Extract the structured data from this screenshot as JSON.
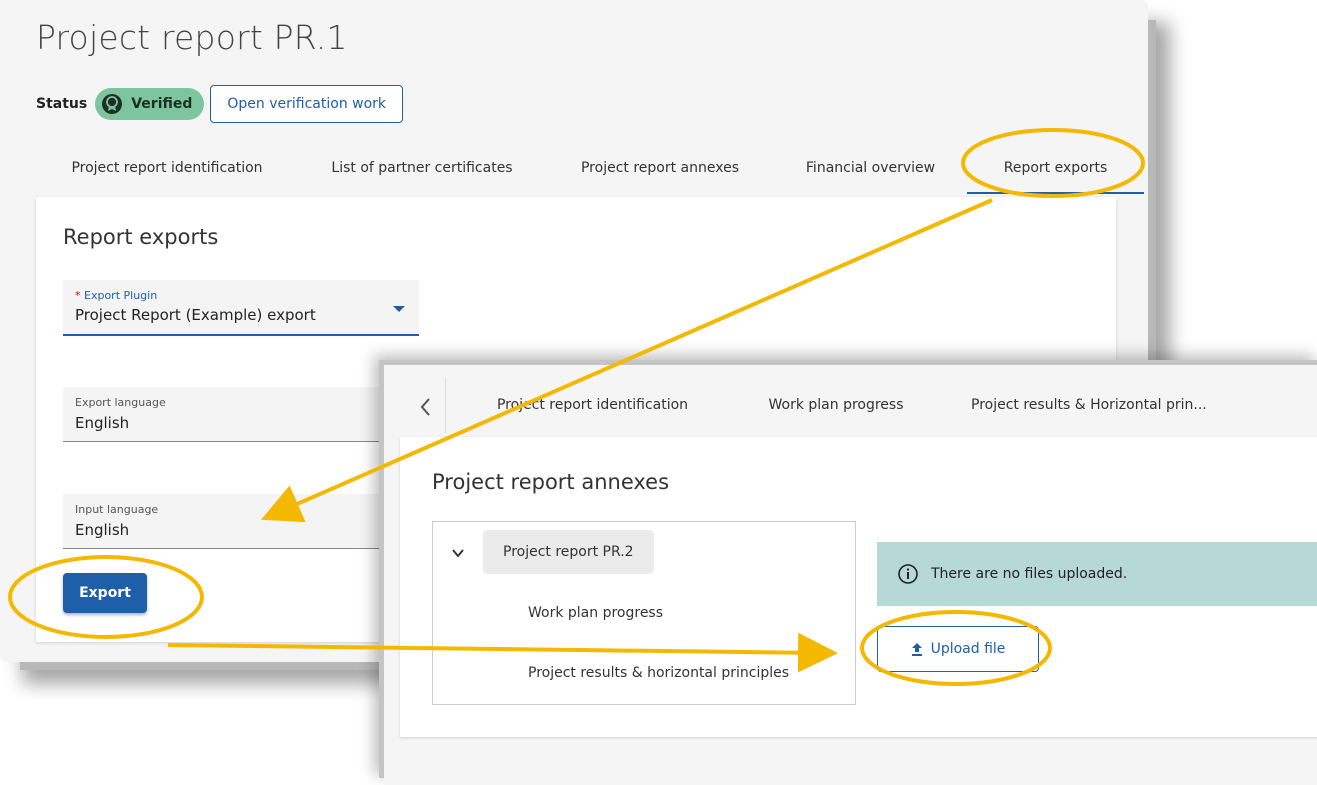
{
  "win1": {
    "title": "Project report PR.1",
    "status_label": "Status",
    "status_badge": "Verified",
    "open_verification_label": "Open verification work",
    "tabs": [
      {
        "label": "Project report identification"
      },
      {
        "label": "List of partner certificates"
      },
      {
        "label": "Project report annexes"
      },
      {
        "label": "Financial overview"
      },
      {
        "label": "Report exports",
        "active": true
      }
    ],
    "card_title": "Report exports",
    "export_plugin": {
      "required_mark": "*",
      "label": "Export Plugin",
      "value": "Project Report (Example) export"
    },
    "export_language": {
      "label": "Export language",
      "value": "English"
    },
    "input_language": {
      "label": "Input language",
      "value": "English"
    },
    "export_button": "Export"
  },
  "win2": {
    "back_icon": "chevron-left-icon",
    "tabs": [
      {
        "label": "Project report identification"
      },
      {
        "label": "Work plan progress"
      },
      {
        "label": "Project results & Horizontal prin..."
      }
    ],
    "card_title": "Project report annexes",
    "tree": {
      "root": "Project report PR.2",
      "items": [
        {
          "label": "Work plan progress"
        },
        {
          "label": "Project results & horizontal principles"
        }
      ]
    },
    "info_message": "There are no files uploaded.",
    "upload_label": "Upload file"
  },
  "colors": {
    "primary": "#1f5ea8",
    "verified_badge": "#7dc69d",
    "info_background": "#b6d9d5",
    "annotation": "#f5b800"
  }
}
